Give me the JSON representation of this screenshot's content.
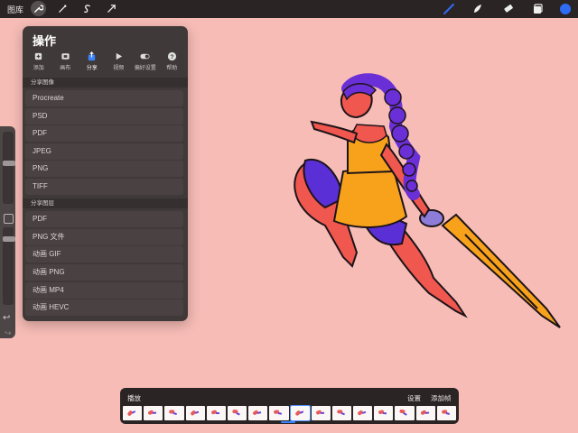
{
  "topbar": {
    "gallery_label": "图库",
    "left_tools": [
      "wrench-icon",
      "magic-wand-icon",
      "selection-s-icon",
      "transform-arrow-icon"
    ],
    "right_tools": [
      "brush-icon",
      "smudge-icon",
      "eraser-icon",
      "layers-icon"
    ],
    "brush_color": "#2f6cf3"
  },
  "actions": {
    "title": "操作",
    "tabs": [
      {
        "label": "添加",
        "icon": "add-icon"
      },
      {
        "label": "画布",
        "icon": "canvas-icon"
      },
      {
        "label": "分享",
        "icon": "share-icon",
        "active": true
      },
      {
        "label": "视频",
        "icon": "video-play-icon"
      },
      {
        "label": "偏好设置",
        "icon": "toggle-icon"
      },
      {
        "label": "帮助",
        "icon": "help-icon"
      }
    ],
    "share_image_header": "分享图像",
    "share_image_items": [
      "Procreate",
      "PSD",
      "PDF",
      "JPEG",
      "PNG",
      "TIFF"
    ],
    "share_layers_header": "分享图层",
    "share_layers_items": [
      "PDF",
      "PNG 文件",
      "动画 GIF",
      "动画 PNG",
      "动画 MP4",
      "动画 HEVC"
    ]
  },
  "timeline": {
    "play_label": "播放",
    "settings_label": "设置",
    "add_frame_label": "添加帧",
    "frame_count": 16
  },
  "colors": {
    "canvas_background": "#f7bcb6",
    "panel": "#403939",
    "accent": "#3c84ff"
  }
}
